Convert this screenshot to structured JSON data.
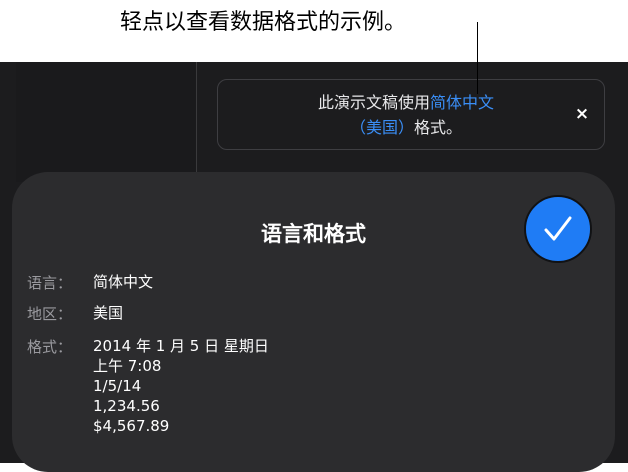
{
  "callout": {
    "text": "轻点以查看数据格式的示例。"
  },
  "banner": {
    "text_before": "此演示文稿使用",
    "language_link": "简体中文",
    "region_link": "（美国）",
    "text_after": "格式。",
    "close_symbol": "×"
  },
  "sheet": {
    "title": "语言和格式",
    "rows": [
      {
        "label": "语言：",
        "value": "简体中文"
      },
      {
        "label": "地区：",
        "value": "美国"
      },
      {
        "label": "格式：",
        "values": [
          "2014 年 1 月 5 日 星期日",
          "上午 7:08",
          "1/5/14",
          "1,234.56",
          "$4,567.89"
        ]
      }
    ]
  },
  "colors": {
    "accent": "#1f7cf5",
    "link": "#3a8ef6",
    "background": "#1c1c1e",
    "sheet": "#2c2c2e"
  },
  "icons": {
    "confirm": "checkmark-icon",
    "close": "close-icon"
  }
}
